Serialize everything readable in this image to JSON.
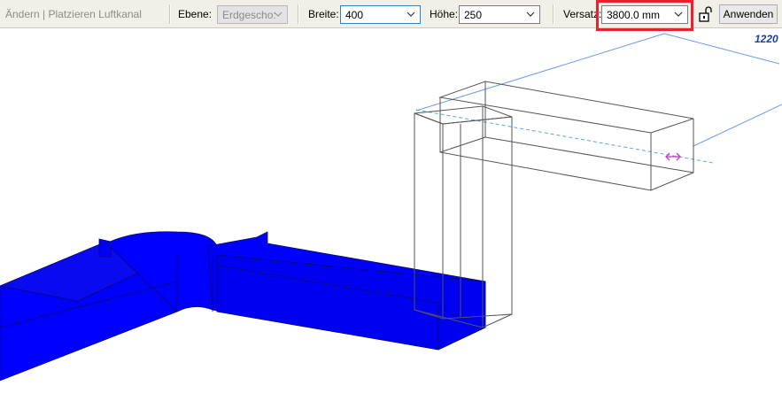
{
  "options_bar": {
    "status": "Ändern | Platzieren Luftkanal",
    "level_label": "Ebene:",
    "level_value": "Erdgescho:",
    "width_label": "Breite:",
    "width_value": "400",
    "height_label": "Höhe:",
    "height_value": "250",
    "offset_label": "Versatz:",
    "offset_value": "3800.0 mm",
    "apply_label": "Anwenden"
  },
  "viewport": {
    "dimension_text": "1220",
    "duct_color": "#0000ff",
    "preview_line_color": "#555555",
    "dimension_line_color": "#6b9cf0"
  },
  "colors": {
    "highlight": "#e8212c",
    "toolbar_bg": "#f0f0e8"
  }
}
